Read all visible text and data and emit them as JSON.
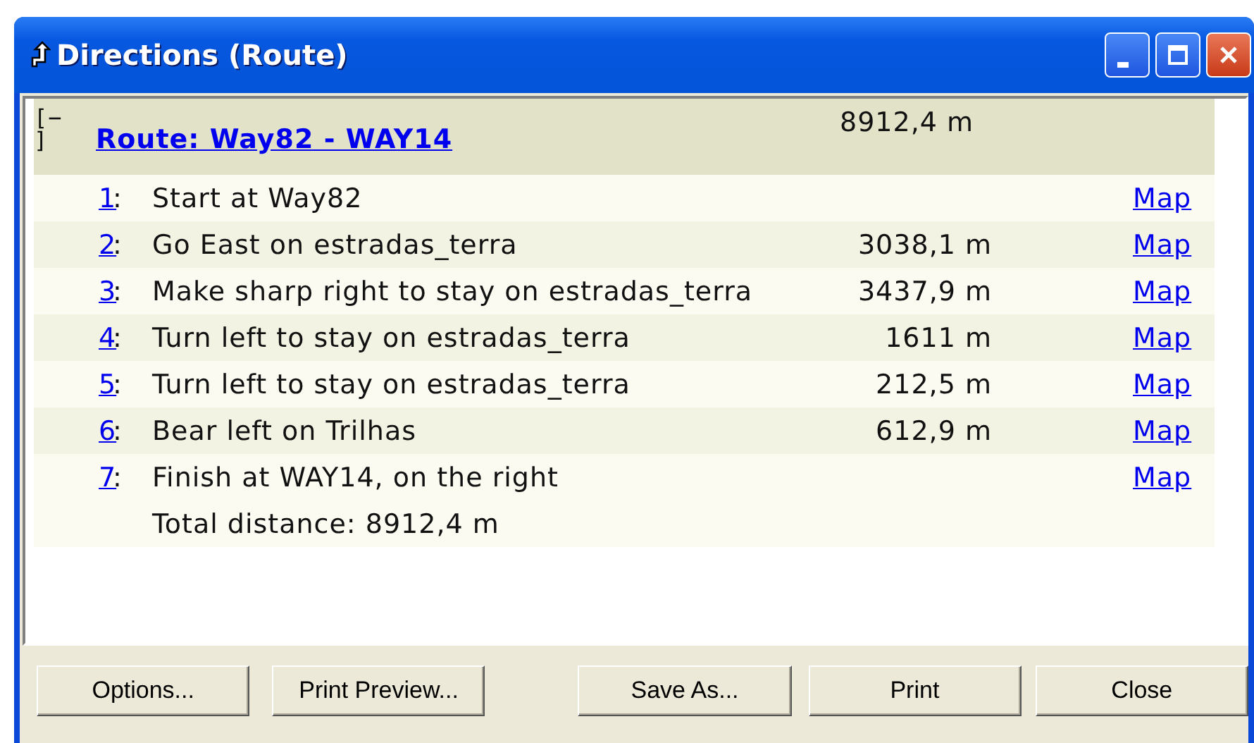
{
  "window": {
    "title": "Directions (Route)"
  },
  "route": {
    "toggle": "[−\n]",
    "title": "Route: Way82 - WAY14",
    "distance": "8912,4 m"
  },
  "steps": [
    {
      "number": "1",
      "separator": ":",
      "text": "Start at Way82",
      "map": "Map"
    },
    {
      "number": "2",
      "separator": ":",
      "text": "Go East on estradas_terra",
      "distance": "3038,1 m",
      "map": "Map"
    },
    {
      "number": "3",
      "separator": ":",
      "text": "Make sharp right to stay on estradas_terra",
      "distance": "3437,9 m",
      "map": "Map"
    },
    {
      "number": "4",
      "separator": ":",
      "text": "Turn left to stay on estradas_terra",
      "distance": "1611 m",
      "map": "Map"
    },
    {
      "number": "5",
      "separator": ":",
      "text": "Turn left to stay on estradas_terra",
      "distance": "212,5 m",
      "map": "Map"
    },
    {
      "number": "6",
      "separator": ":",
      "text": "Bear left on Trilhas",
      "distance": "612,9 m",
      "map": "Map"
    },
    {
      "number": "7",
      "separator": ":",
      "text": "Finish at WAY14, on the right",
      "map": "Map"
    }
  ],
  "total": "Total distance: 8912,4 m",
  "buttons": [
    "Options...",
    "Print Preview...",
    "Save As...",
    "Print",
    "Close"
  ]
}
